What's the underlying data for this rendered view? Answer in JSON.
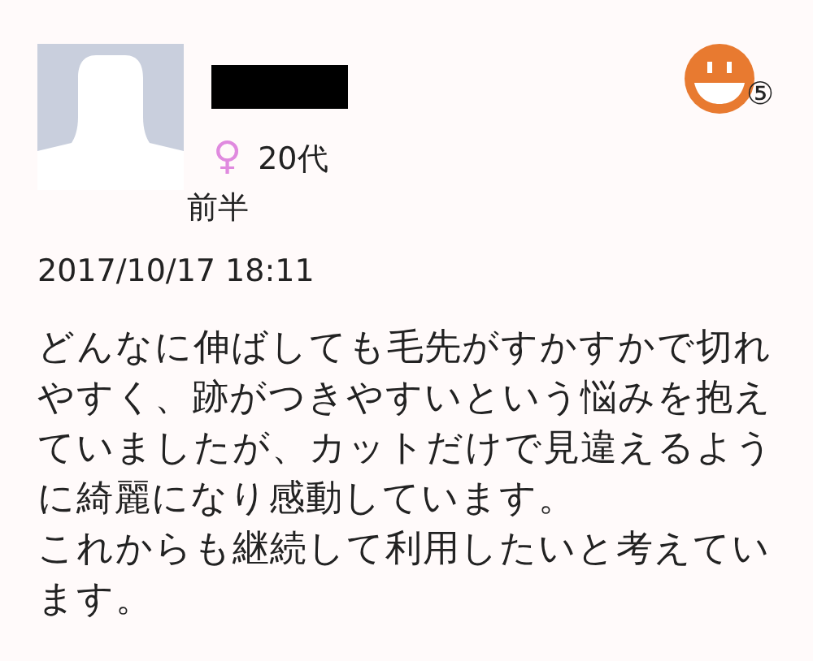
{
  "review": {
    "author": {
      "name_redacted": true,
      "gender_symbol": "♀",
      "age_lines": [
        "20代",
        "前半"
      ]
    },
    "rating_badge": "⑤",
    "date": "2017/10/17 18:11",
    "paragraphs": [
      "どんなに伸ばしても毛先がすかすかで切れやすく、跡がつきやすいという悩みを抱えていましたが、カットだけで見違えるように綺麗になり感動しています。",
      "これからも継続して利用したいと考えています。"
    ]
  }
}
